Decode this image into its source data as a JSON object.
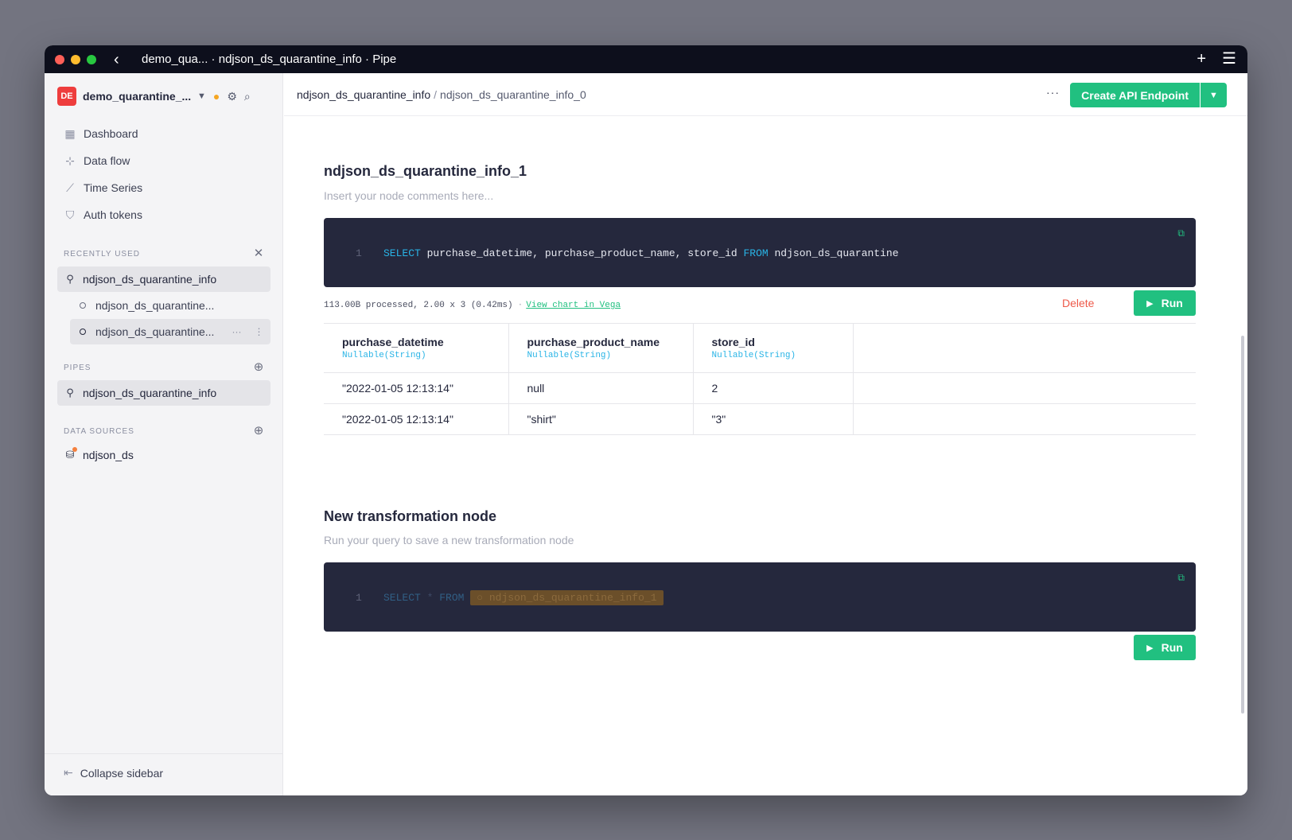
{
  "window": {
    "title": "demo_qua... · ndjson_ds_quarantine_info · Pipe"
  },
  "sidebar": {
    "workspace_badge": "DE",
    "workspace_name": "demo_quarantine_...",
    "nav": [
      {
        "label": "Dashboard",
        "icon": "dashboard-icon"
      },
      {
        "label": "Data flow",
        "icon": "data-flow-icon"
      },
      {
        "label": "Time Series",
        "icon": "time-series-icon"
      },
      {
        "label": "Auth tokens",
        "icon": "shield-icon"
      }
    ],
    "recently_used_label": "RECENTLY USED",
    "recently_used": {
      "pipe": "ndjson_ds_quarantine_info",
      "nodes": [
        "ndjson_ds_quarantine...",
        "ndjson_ds_quarantine..."
      ]
    },
    "pipes_label": "PIPES",
    "pipes": [
      "ndjson_ds_quarantine_info"
    ],
    "data_sources_label": "DATA SOURCES",
    "data_sources": [
      "ndjson_ds"
    ],
    "collapse_label": "Collapse sidebar"
  },
  "header": {
    "breadcrumb_pipe": "ndjson_ds_quarantine_info",
    "breadcrumb_separator": "/",
    "breadcrumb_node": "ndjson_ds_quarantine_info_0",
    "more": "···",
    "create_endpoint_label": "Create API Endpoint"
  },
  "node1": {
    "title": "ndjson_ds_quarantine_info_1",
    "comment_placeholder": "Insert your node comments here...",
    "line_number": "1",
    "sql_kw1": "SELECT",
    "sql_cols": " purchase_datetime, purchase_product_name, store_id ",
    "sql_kw2": "FROM",
    "sql_table": " ndjson_ds_quarantine",
    "stats": "113.00B processed, 2.00 x 3 (0.42ms)",
    "stats_sep": "·",
    "view_chart": "View chart in Vega",
    "delete_label": "Delete",
    "run_label": "Run",
    "columns": [
      {
        "name": "purchase_datetime",
        "type": "Nullable(String)"
      },
      {
        "name": "purchase_product_name",
        "type": "Nullable(String)"
      },
      {
        "name": "store_id",
        "type": "Nullable(String)"
      }
    ],
    "rows": [
      [
        "\"2022-01-05 12:13:14\"",
        "null",
        "2"
      ],
      [
        "\"2022-01-05 12:13:14\"",
        "\"shirt\"",
        "\"3\""
      ]
    ]
  },
  "node2": {
    "title": "New transformation node",
    "description": "Run your query to save a new transformation node",
    "line_number": "1",
    "sql_kw1": "SELECT",
    "sql_star": " * ",
    "sql_kw2": "FROM",
    "pipe_ref": "ndjson_ds_quarantine_info_1",
    "run_label": "Run"
  }
}
